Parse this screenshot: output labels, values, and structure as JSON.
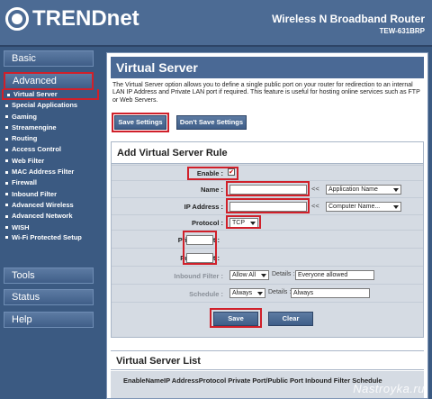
{
  "header": {
    "brand": "TRENDnet",
    "product_title": "Wireless N Broadband Router",
    "model": "TEW-631BRP"
  },
  "sidebar": {
    "sections": {
      "basic": "Basic",
      "advanced": "Advanced",
      "tools": "Tools",
      "status": "Status",
      "help": "Help"
    },
    "items": [
      "Virtual Server",
      "Special Applications",
      "Gaming",
      "Streamengine",
      "Routing",
      "Access Control",
      "Web Filter",
      "MAC Address Filter",
      "Firewall",
      "Inbound Filter",
      "Advanced Wireless",
      "Advanced Network",
      "WISH",
      "Wi-Fi Protected Setup"
    ]
  },
  "main": {
    "title": "Virtual Server",
    "description": "The Virtual Server option allows you to define a single public port on your router for redirection to an internal LAN IP Address and Private LAN port if required. This feature is useful for hosting online services such as FTP or Web Servers.",
    "save_settings": "Save Settings",
    "dont_save_settings": "Don't Save Settings"
  },
  "rule_form": {
    "title": "Add Virtual Server Rule",
    "enable_label": "Enable :",
    "enable_mark": "✔",
    "name_label": "Name :",
    "name_value": "",
    "name_chevron": "<<",
    "name_select": "Application Name",
    "ip_label": "IP Address :",
    "ip_value": "",
    "ip_chevron": "<<",
    "ip_select": "Computer Name...",
    "protocol_label": "Protocol :",
    "protocol_value": "TCP",
    "private_port_label": "Private port :",
    "private_port_value": "",
    "public_port_label": "Public port :",
    "public_port_value": "",
    "inbound_filter_label": "Inbound Filter :",
    "inbound_filter_value": "Allow All",
    "inbound_details_label": "Details :",
    "inbound_details_value": "Everyone allowed",
    "schedule_label": "Schedule :",
    "schedule_value": "Always",
    "schedule_details_label": "Details :",
    "schedule_details_value": "Always",
    "save_button": "Save",
    "clear_button": "Clear"
  },
  "server_list": {
    "title": "Virtual Server List",
    "columns": "EnableNameIP AddressProtocol Private Port/Public Port  Inbound Filter Schedule"
  },
  "watermark": "Nastroyka.ru",
  "colors": {
    "highlight_red": "#d0202a",
    "panel_blue": "#4a6995"
  }
}
